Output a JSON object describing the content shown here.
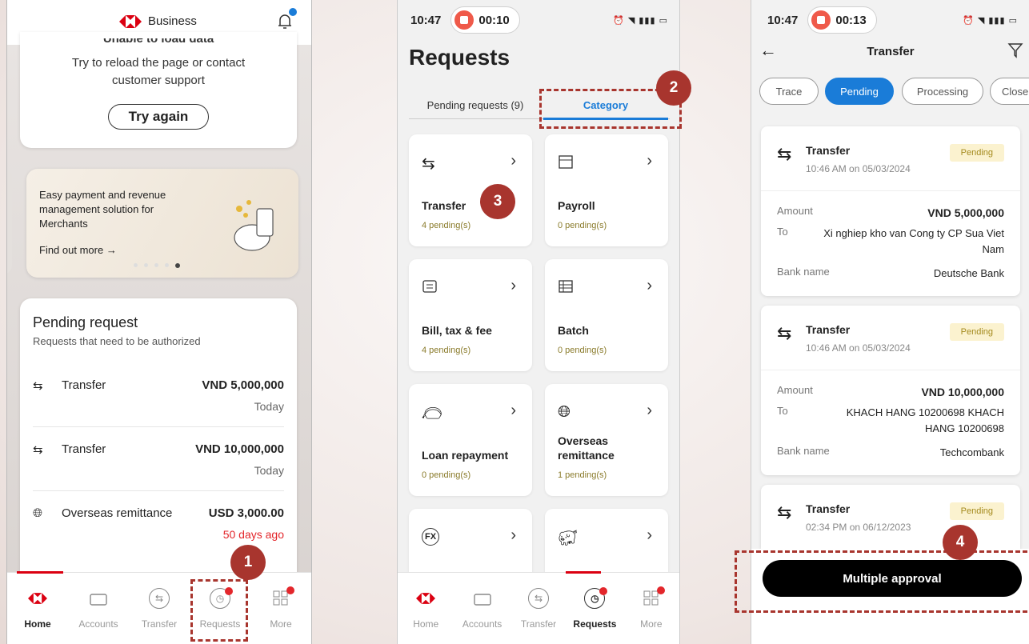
{
  "steps": {
    "s1": "1",
    "s2": "2",
    "s3": "3",
    "s4": "4"
  },
  "screen1": {
    "brand": "Business",
    "error_cut": "Unable to load data",
    "error_msg_1": "Try to reload the page or contact",
    "error_msg_2": "customer support",
    "try_again": "Try again",
    "promo_line1": "Easy payment and revenue",
    "promo_line2": "management solution for",
    "promo_line3": "Merchants",
    "promo_link": "Find out more →",
    "pending_title": "Pending request",
    "pending_sub": "Requests that need to be authorized",
    "rows": [
      {
        "name": "Transfer",
        "amount": "VND 5,000,000",
        "when": "Today"
      },
      {
        "name": "Transfer",
        "amount": "VND 10,000,000",
        "when": "Today"
      },
      {
        "name": "Overseas remittance",
        "amount": "USD 3,000.00",
        "when": "50 days ago"
      }
    ],
    "nav": [
      "Home",
      "Accounts",
      "Transfer",
      "Requests",
      "More"
    ]
  },
  "screen2": {
    "time": "10:47",
    "rec": "00:10",
    "title": "Requests",
    "tab1": "Pending requests (9)",
    "tab2": "Category",
    "cats": [
      {
        "name": "Transfer",
        "pending": "4 pending(s)"
      },
      {
        "name": "Payroll",
        "pending": "0 pending(s)"
      },
      {
        "name": "Bill, tax & fee",
        "pending": "4 pending(s)"
      },
      {
        "name": "Batch",
        "pending": "0 pending(s)"
      },
      {
        "name": "Loan repayment",
        "pending": "0 pending(s)"
      },
      {
        "name": "Overseas remittance",
        "pending": "1 pending(s)"
      }
    ],
    "nav": [
      "Home",
      "Accounts",
      "Transfer",
      "Requests",
      "More"
    ]
  },
  "screen3": {
    "time": "10:47",
    "rec": "00:13",
    "title": "Transfer",
    "pills": [
      "Trace",
      "Pending",
      "Processing",
      "Close"
    ],
    "items": [
      {
        "type": "Transfer",
        "time": "10:46 AM on 05/03/2024",
        "status": "Pending",
        "amount": "VND 5,000,000",
        "to": "Xi nghiep kho van Cong ty CP Sua Viet Nam",
        "bank": "Deutsche Bank"
      },
      {
        "type": "Transfer",
        "time": "10:46 AM on 05/03/2024",
        "status": "Pending",
        "amount": "VND 10,000,000",
        "to": "KHACH HANG 10200698 KHACH HANG 10200698",
        "bank": "Techcombank"
      },
      {
        "type": "Transfer",
        "time": "02:34 PM on 06/12/2023",
        "status": "Pending"
      }
    ],
    "labels": {
      "amount": "Amount",
      "to": "To",
      "bank": "Bank name"
    },
    "approve": "Multiple approval"
  },
  "colors": {
    "brand_red": "#db0011",
    "accent_blue": "#1a7cd8",
    "step_red": "#a8352e"
  },
  "icons": [
    "bell-icon",
    "transfer-arrows-icon",
    "globe-icon",
    "calendar-icon",
    "bill-icon",
    "table-icon",
    "money-bag-icon",
    "fx-icon",
    "piggy-icon",
    "back-arrow-icon",
    "filter-icon"
  ]
}
